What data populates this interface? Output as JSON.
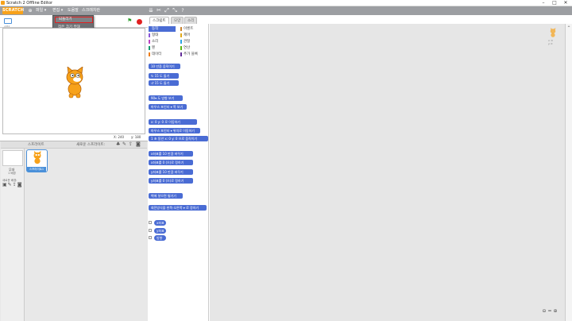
{
  "window": {
    "title": "Scratch 2 Offline Editor"
  },
  "logo": "SCRATCH",
  "menu": {
    "file": "파일 ▾",
    "edit": "편집 ▾",
    "help": "도움말",
    "about": "스크래치란"
  },
  "dropdown": [
    "되돌리기",
    "작은 크기 무대",
    "터보 모드"
  ],
  "stage": {
    "version": "v461",
    "coords_x": "X: 240",
    "coords_y": "y: 180"
  },
  "sprites": {
    "header": "스프라이트",
    "new_sprite": "새로운 스프라이트:",
    "stage_label": "무대",
    "stage_count": "1 배경",
    "new_backdrop": "새로운 배경:",
    "sprite1": "스프라이트1"
  },
  "tabs": [
    "스크립트",
    "모양",
    "소리"
  ],
  "categories": [
    {
      "label": "동작",
      "color": "#4a6cd4"
    },
    {
      "label": "형태",
      "color": "#8a55d7"
    },
    {
      "label": "소리",
      "color": "#bb42c3"
    },
    {
      "label": "펜",
      "color": "#0e9a6c"
    },
    {
      "label": "데이터",
      "color": "#ee7d16"
    },
    {
      "label": "이벤트",
      "color": "#c88330"
    },
    {
      "label": "제어",
      "color": "#e1a91a"
    },
    {
      "label": "관찰",
      "color": "#2ca5e2"
    },
    {
      "label": "연산",
      "color": "#5cb712"
    },
    {
      "label": "추가 블록",
      "color": "#632d99"
    }
  ],
  "blocks": [
    "10 만큼 움직이기",
    "↻ 15 도 돌기",
    "↺ 15 도 돌기",
    "90▾ 도 방향 보기",
    "마우스 포인터 ▾ 쪽 보기",
    "x: 0 y: 0 로 이동하기",
    "마우스 포인터 ▾ 위치로 이동하기",
    "1 초 동안 x: 0 y: 0 으로 움직이기",
    "x좌표를 10 만큼 바꾸기",
    "x좌표를 0 (으)로 정하기",
    "y좌표를 10 만큼 바꾸기",
    "y좌표를 0 (으)로 정하기",
    "벽에 닿으면 튕기기",
    "회전방식을 왼쪽-오른쪽 ▾ 로 정하기"
  ],
  "reporters": [
    "x좌표",
    "y좌표",
    "방향"
  ],
  "sprite_info": {
    "x": "x: 0",
    "y": "y: 0"
  }
}
